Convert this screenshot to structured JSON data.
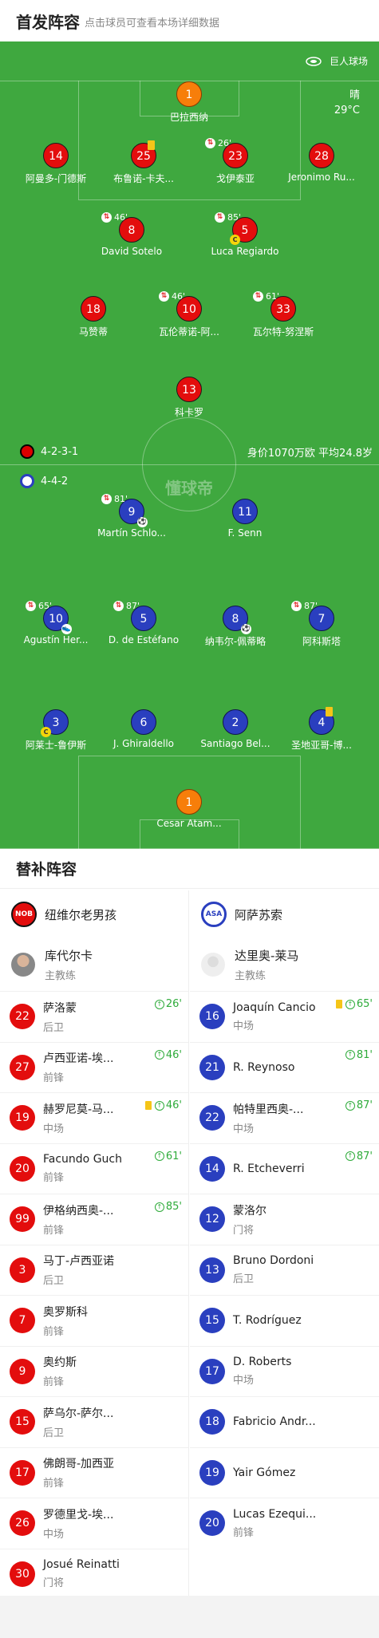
{
  "header": {
    "title": "首发阵容",
    "subtitle": "点击球员可查看本场详细数据"
  },
  "pitch": {
    "stadium": "巨人球场",
    "weather": "晴",
    "temperature": "29°C",
    "watermark": "懂球帝",
    "home": {
      "formation": "4-2-3-1",
      "color": "#e30d0d"
    },
    "away": {
      "formation": "4-4-2",
      "color": "#2a3fbf"
    },
    "value_info": "身价1070万欧 平均24.8岁",
    "home_players": [
      {
        "num": "1",
        "name": "巴拉西纳",
        "gk": true
      },
      {
        "num": "14",
        "name": "阿曼多-门德斯"
      },
      {
        "num": "25",
        "name": "布鲁诺-卡夫...",
        "yellow": true
      },
      {
        "num": "23",
        "name": "戈伊泰亚",
        "sub": "26'"
      },
      {
        "num": "28",
        "name": "Jeronimo Ru..."
      },
      {
        "num": "8",
        "name": "David Sotelo",
        "sub": "46'"
      },
      {
        "num": "5",
        "name": "Luca Regiardo",
        "sub": "85'",
        "captain": true
      },
      {
        "num": "18",
        "name": "马赞蒂"
      },
      {
        "num": "10",
        "name": "瓦伦蒂诺-阿...",
        "sub": "46'"
      },
      {
        "num": "33",
        "name": "瓦尔特-努涅斯",
        "sub": "61'"
      },
      {
        "num": "13",
        "name": "科卡罗"
      }
    ],
    "away_players": [
      {
        "num": "9",
        "name": "Martín Schlo...",
        "sub": "81'",
        "goal": true
      },
      {
        "num": "11",
        "name": "F. Senn"
      },
      {
        "num": "10",
        "name": "Agustín Her...",
        "sub": "65'",
        "assist": true
      },
      {
        "num": "5",
        "name": "D. de Estéfano",
        "sub": "87'"
      },
      {
        "num": "8",
        "name": "纳韦尔-佩蒂略",
        "goal": true
      },
      {
        "num": "7",
        "name": "阿科斯塔",
        "sub": "87'"
      },
      {
        "num": "3",
        "name": "阿莱士-鲁伊斯",
        "captain": true
      },
      {
        "num": "6",
        "name": "J. Ghiraldello"
      },
      {
        "num": "2",
        "name": "Santiago Bel..."
      },
      {
        "num": "4",
        "name": "圣地亚哥-博...",
        "yellow": true
      },
      {
        "num": "1",
        "name": "Cesar Atam...",
        "gk": true
      }
    ]
  },
  "subs": {
    "title": "替补阵容",
    "home": {
      "team": "纽维尔老男孩",
      "logo_text": "NOB",
      "coach": "库代尔卡",
      "coach_role": "主教练",
      "players": [
        {
          "num": "22",
          "name": "萨洛蒙",
          "pos": "后卫",
          "in": "26'"
        },
        {
          "num": "27",
          "name": "卢西亚诺-埃...",
          "pos": "前锋",
          "in": "46'"
        },
        {
          "num": "19",
          "name": "赫罗尼莫-马...",
          "pos": "中场",
          "in": "46'",
          "yellow": true
        },
        {
          "num": "20",
          "name": "Facundo Guch",
          "pos": "前锋",
          "in": "61'"
        },
        {
          "num": "99",
          "name": "伊格纳西奥-...",
          "pos": "前锋",
          "in": "85'"
        },
        {
          "num": "3",
          "name": "马丁-卢西亚诺",
          "pos": "后卫"
        },
        {
          "num": "7",
          "name": "奥罗斯科",
          "pos": "前锋"
        },
        {
          "num": "9",
          "name": "奥约斯",
          "pos": "前锋"
        },
        {
          "num": "15",
          "name": "萨乌尔-萨尔...",
          "pos": "后卫"
        },
        {
          "num": "17",
          "name": "佛朗哥-加西亚",
          "pos": "前锋"
        },
        {
          "num": "26",
          "name": "罗德里戈-埃...",
          "pos": "中场"
        },
        {
          "num": "30",
          "name": "Josué Reinatti",
          "pos": "门将"
        }
      ]
    },
    "away": {
      "team": "阿萨苏索",
      "logo_text": "ASA",
      "coach": "达里奥-莱马",
      "coach_role": "主教练",
      "players": [
        {
          "num": "16",
          "name": "Joaquín Cancio",
          "pos": "中场",
          "in": "65'",
          "yellow": true
        },
        {
          "num": "21",
          "name": "R. Reynoso",
          "pos": "",
          "in": "81'"
        },
        {
          "num": "22",
          "name": "帕特里西奥-...",
          "pos": "中场",
          "in": "87'"
        },
        {
          "num": "14",
          "name": "R. Etcheverri",
          "pos": "",
          "in": "87'"
        },
        {
          "num": "12",
          "name": "蒙洛尔",
          "pos": "门将"
        },
        {
          "num": "13",
          "name": "Bruno Dordoni",
          "pos": "后卫"
        },
        {
          "num": "15",
          "name": "T. Rodríguez",
          "pos": ""
        },
        {
          "num": "17",
          "name": "D. Roberts",
          "pos": "中场"
        },
        {
          "num": "18",
          "name": "Fabricio Andr...",
          "pos": ""
        },
        {
          "num": "19",
          "name": "Yair Gómez",
          "pos": ""
        },
        {
          "num": "20",
          "name": "Lucas Ezequi...",
          "pos": "前锋"
        }
      ]
    }
  }
}
